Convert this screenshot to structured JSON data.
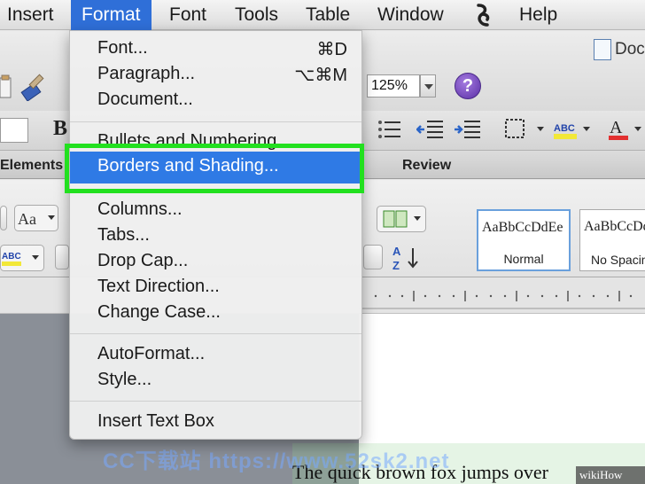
{
  "menubar": {
    "items": [
      "Insert",
      "Format",
      "Font",
      "Tools",
      "Table",
      "Window",
      "Help"
    ],
    "active": "Format"
  },
  "window": {
    "doc_title": "Doc"
  },
  "toolbar": {
    "zoom": "125%",
    "help": "?",
    "bold_label": "B"
  },
  "tabs": {
    "elements": "Elements",
    "review": "Review"
  },
  "styles": [
    {
      "sample": "AaBbCcDdEe",
      "name": "Normal"
    },
    {
      "sample": "AaBbCcDdEe",
      "name": "No Spacing"
    }
  ],
  "format_menu": {
    "items": [
      {
        "label": "Font...",
        "shortcut": "⌘D"
      },
      {
        "label": "Paragraph...",
        "shortcut": "⌥⌘M"
      },
      {
        "label": "Document...",
        "shortcut": ""
      },
      {
        "label": "Bullets and Numbering...",
        "shortcut": ""
      },
      {
        "label": "Borders and Shading...",
        "shortcut": ""
      },
      {
        "label": "Columns...",
        "shortcut": ""
      },
      {
        "label": "Tabs...",
        "shortcut": ""
      },
      {
        "label": "Drop Cap...",
        "shortcut": ""
      },
      {
        "label": "Text Direction...",
        "shortcut": ""
      },
      {
        "label": "Change Case...",
        "shortcut": ""
      },
      {
        "label": "AutoFormat...",
        "shortcut": ""
      },
      {
        "label": "Style...",
        "shortcut": ""
      },
      {
        "label": "Insert Text Box",
        "shortcut": ""
      }
    ],
    "highlighted": "Borders and Shading..."
  },
  "document": {
    "text": "The quick brown fox jumps over"
  },
  "overlays": {
    "watermark": "CC下载站 https://www.52sk2.net",
    "badge": "wikiHow"
  },
  "colors": {
    "menu_highlight": "#2f7ae5",
    "annotation_box": "#22e01f",
    "active_menu": "#2f6fd8"
  }
}
